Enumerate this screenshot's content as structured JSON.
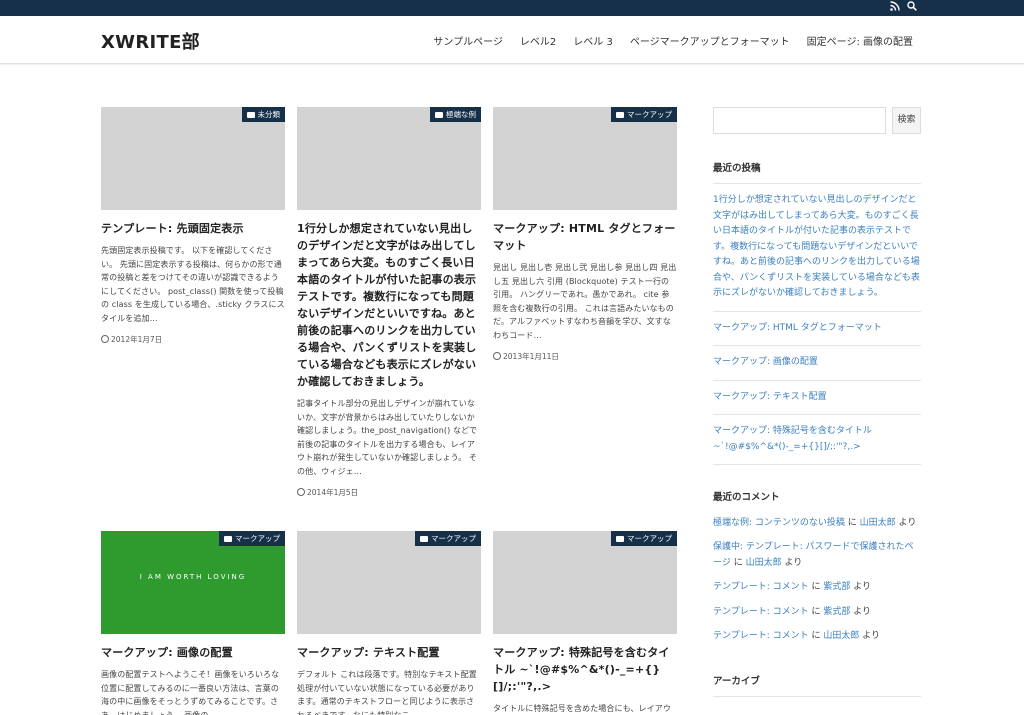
{
  "header": {
    "site_title": "XWRITE部",
    "nav": [
      "サンプルページ",
      "レベル2",
      "レベル 3",
      "ページマークアップとフォーマット",
      "固定ページ: 画像の配置"
    ]
  },
  "topbar": {
    "icons": [
      "rss-icon",
      "search-icon"
    ]
  },
  "posts": [
    {
      "category": "未分類",
      "title": "テンプレート: 先頭固定表示",
      "excerpt": "先頭固定表示投稿です。 以下を確認してください。 先頭に固定表示する投稿は、何らかの形で通常の投稿と差をつけてその違いが認識できるようにしてください。 post_class() 関数を使って投稿の class を生成している場合、.sticky クラスにスタイルを追加…",
      "date": "2012年1月7日"
    },
    {
      "category": "極端な例",
      "title": "1行分しか想定されていない見出しのデザインだと文字がはみ出してしまってあら大変。ものすごく長い日本語のタイトルが付いた記事の表示テストです。複数行になっても問題ないデザインだといいですね。あと前後の記事へのリンクを出力している場合や、パンくずリストを実装している場合なども表示にズレがないか確認しておきましょう。",
      "excerpt": "記事タイトル部分の見出しデザインが崩れていないか、文字が背景からはみ出していたりしないか確認しましょう。the_post_navigation() などで前後の記事のタイトルを出力する場合も、レイアウト崩れが発生していないか確認しましょう。 その他、ウィジェ…",
      "date": "2014年1月5日"
    },
    {
      "category": "マークアップ",
      "title": "マークアップ: HTML タグとフォーマット",
      "excerpt": "見出し 見出し壱 見出し弐 見出し参 見出し四 見出し五 見出し六 引用 (Blockquote) テスト一行の引用。 ハングリーであれ。愚かであれ。 cite 参照を含む複数行の引用。 これは言語みたいなものだ。アルファベットすなわち音韻を学び、文すなわちコード…",
      "date": "2013年1月11日"
    },
    {
      "category": "マークアップ",
      "title": "マークアップ: 画像の配置",
      "excerpt": "画像の配置テストへようこそ！画像をいろいろな位置に配置してみるのに一番良い方法は、言葉の海の中に画像をそっとうずめてみることです。さあ、はじめましょう。 画像の",
      "thumb_text": "I AM WORTH LOVING"
    },
    {
      "category": "マークアップ",
      "title": "マークアップ: テキスト配置",
      "excerpt": "デフォルト これは段落です。特別なテキスト配置処理が付いていない状態になっている必要があります。通常のテキストフローと同じように表示されるべきです。なにも特別なこ"
    },
    {
      "category": "マークアップ",
      "title": "マークアップ: 特殊記号を含むタイトル ~`!@#$%^&*()-_=+{}[]/;:'\"?,.>",
      "excerpt": "タイトルに特殊記号を含めた場合にも、レイアウトや機能に悪影響が出ないようにする必要があります。 投稿タイトルの中で特殊記号は"
    }
  ],
  "sidebar": {
    "search_button": "検索",
    "recent_posts_heading": "最近の投稿",
    "recent_posts": [
      "1行分しか想定されていない見出しのデザインだと文字がはみ出してしまってあら大変。ものすごく長い日本語のタイトルが付いた記事の表示テストです。複数行になっても問題ないデザインだといいですね。あと前後の記事へのリンクを出力している場合や、パンくずリストを実装している場合なども表示にズレがないか確認しておきましょう。",
      "マークアップ: HTML タグとフォーマット",
      "マークアップ: 画像の配置",
      "マークアップ: テキスト配置",
      "マークアップ: 特殊記号を含むタイトル ~`!@#$%^&*()-_=+{}[]/;:'\"?,.>"
    ],
    "recent_comments_heading": "最近のコメント",
    "recent_comments": [
      {
        "post": "極端な例: コンテンツのない投稿",
        "sep": " に ",
        "author": "山田太郎",
        "suffix": " より"
      },
      {
        "post": "保護中: テンプレート: パスワードで保護されたページ",
        "sep": " に ",
        "author": "山田太郎",
        "suffix": " より"
      },
      {
        "post": "テンプレート: コメント",
        "sep": " に ",
        "author": "紫式部",
        "suffix": " より"
      },
      {
        "post": "テンプレート: コメント",
        "sep": " に ",
        "author": "紫式部",
        "suffix": " より"
      },
      {
        "post": "テンプレート: コメント",
        "sep": " に ",
        "author": "山田太郎",
        "suffix": " より"
      }
    ],
    "archives_heading": "アーカイブ"
  }
}
